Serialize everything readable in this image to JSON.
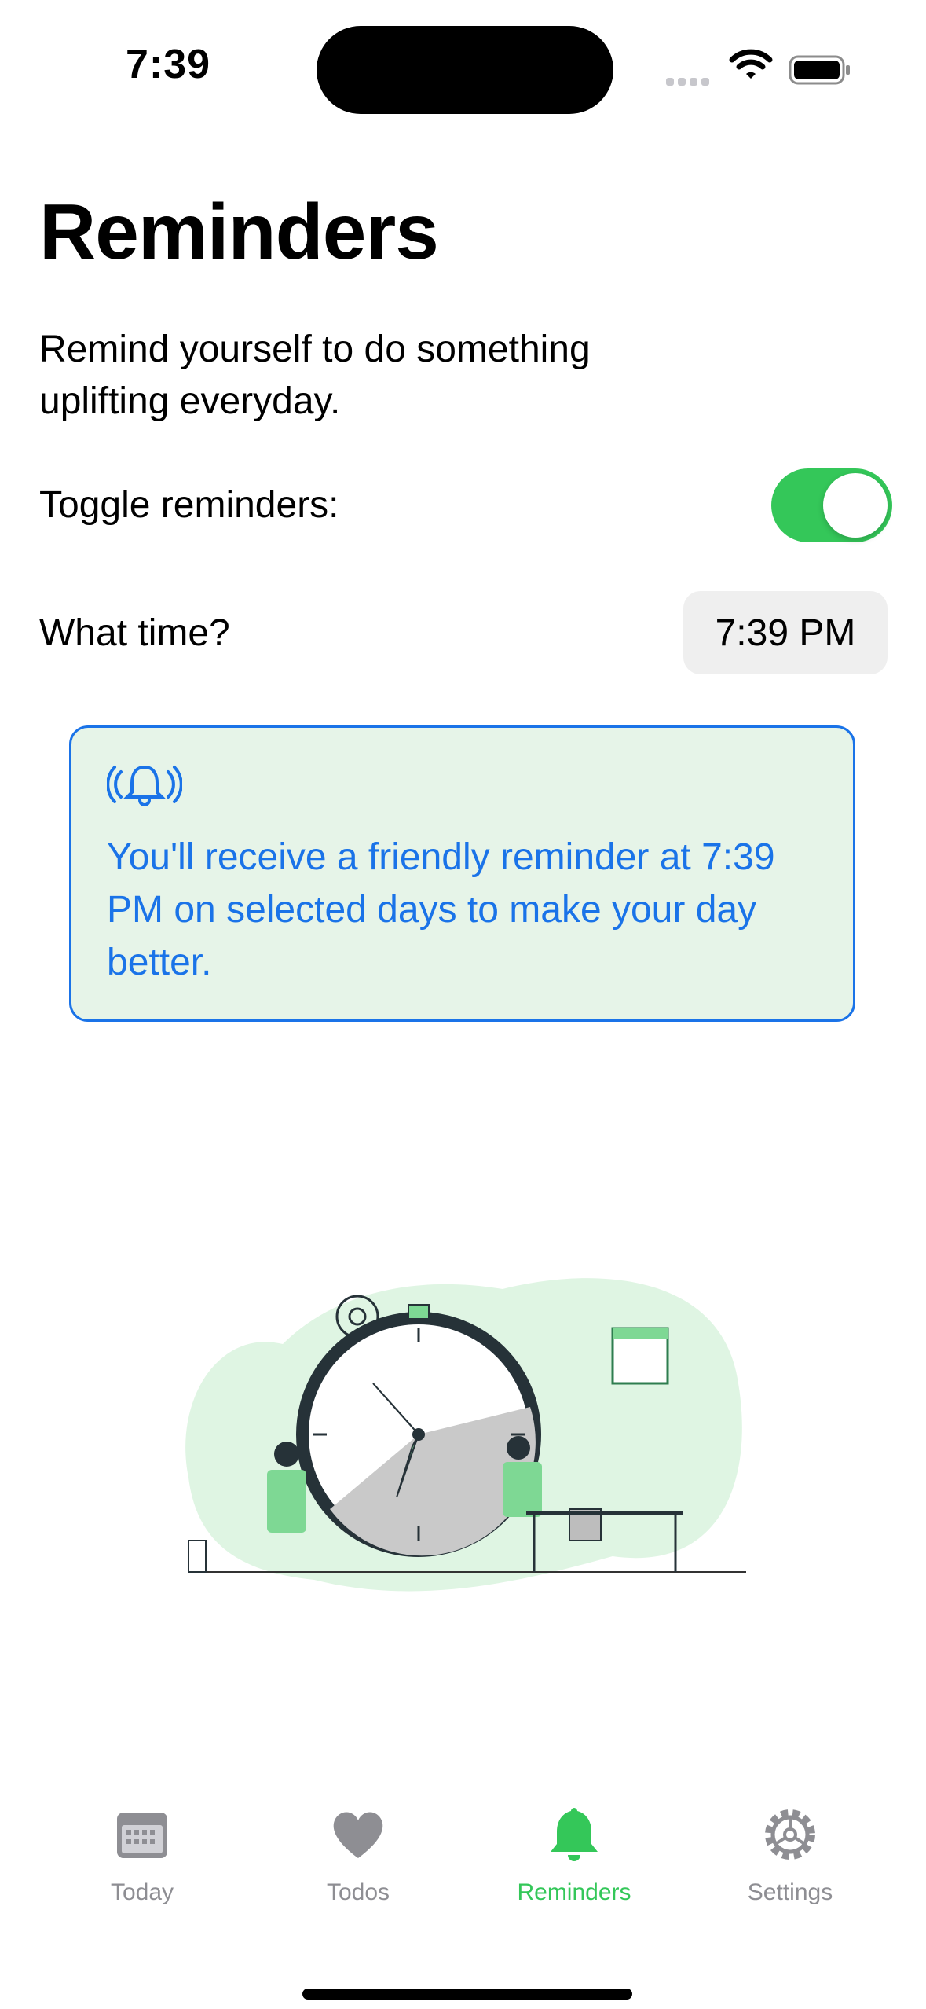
{
  "status_bar": {
    "time": "7:39"
  },
  "page": {
    "title": "Reminders",
    "description": "Remind yourself to do something uplifting everyday.",
    "toggle_label": "Toggle reminders:",
    "toggle_on": true,
    "time_label": "What time?",
    "time_value": "7:39 PM"
  },
  "info_card": {
    "icon": "bell-ringing-icon",
    "text": "You'll receive a friendly reminder at 7:39 PM on selected days to make your day better."
  },
  "colors": {
    "accent_green": "#34c759",
    "info_blue": "#1a73e8",
    "info_bg": "#e6f4e8"
  },
  "tabs": [
    {
      "label": "Today",
      "icon": "calendar-icon",
      "active": false
    },
    {
      "label": "Todos",
      "icon": "heart-icon",
      "active": false
    },
    {
      "label": "Reminders",
      "icon": "bell-icon",
      "active": true
    },
    {
      "label": "Settings",
      "icon": "gear-icon",
      "active": false
    }
  ]
}
